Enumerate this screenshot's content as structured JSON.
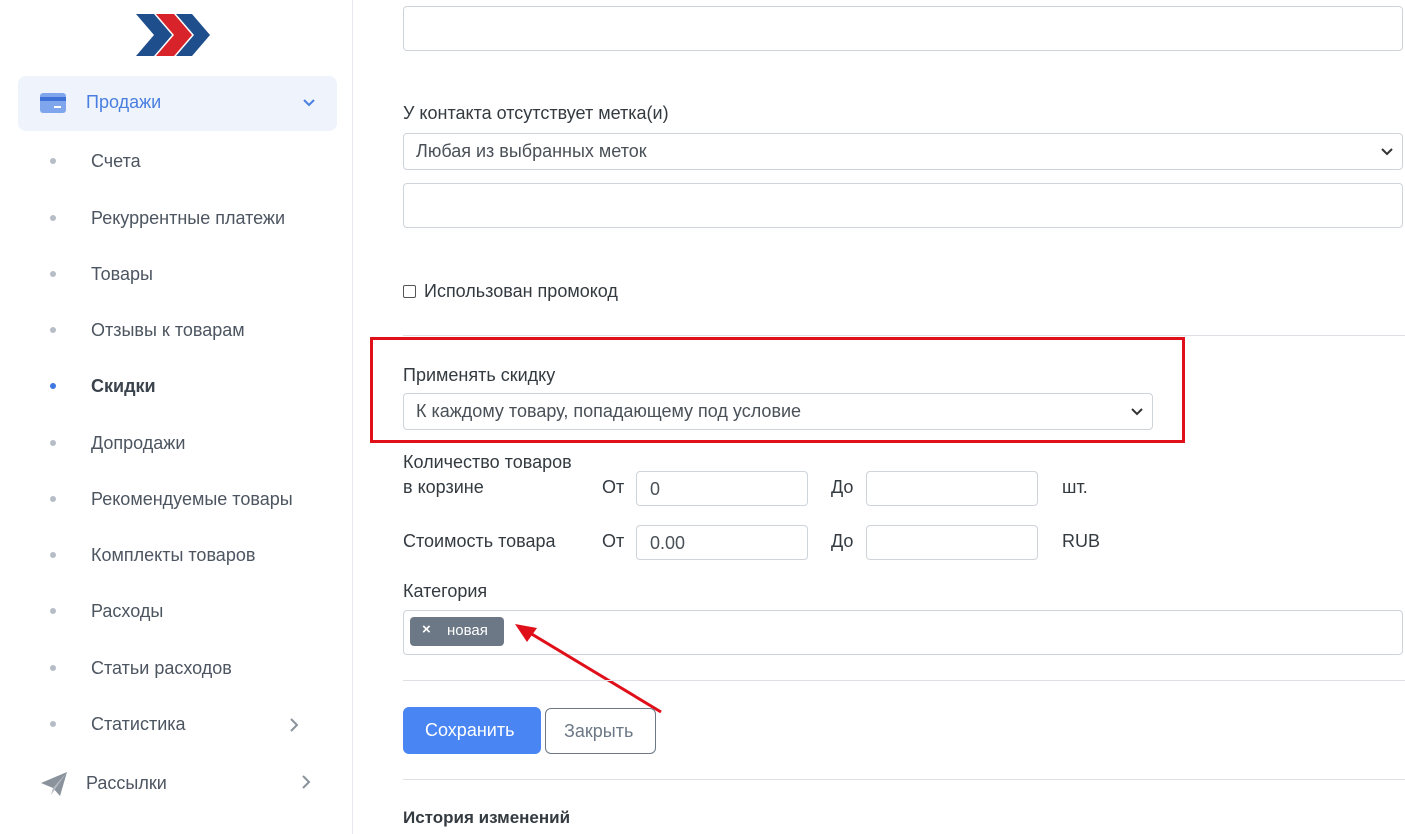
{
  "sidebar": {
    "logo_icon": "chevrons-logo-icon",
    "sales": {
      "label": "Продажи",
      "icon": "card-icon",
      "expanded": true
    },
    "items": [
      {
        "label": "Счета"
      },
      {
        "label": "Рекуррентные платежи"
      },
      {
        "label": "Товары"
      },
      {
        "label": "Отзывы к товарам"
      },
      {
        "label": "Скидки",
        "active": true
      },
      {
        "label": "Допродажи"
      },
      {
        "label": "Рекомендуемые товары"
      },
      {
        "label": "Комплекты товаров"
      },
      {
        "label": "Расходы"
      },
      {
        "label": "Статьи расходов"
      },
      {
        "label": "Статистика",
        "has_submenu": true
      }
    ],
    "mailings": {
      "label": "Рассылки",
      "icon": "paper-plane-icon"
    }
  },
  "form": {
    "tag_missing_label": "У контакта отсутствует метка(и)",
    "tag_missing_mode": "Любая из выбранных меток",
    "promo_label": "Использован промокод",
    "promo_checked": false,
    "apply_discount_label": "Применять скидку",
    "apply_discount_value": "К каждому товару, попадающему под условие",
    "qty_label_line1": "Количество товаров",
    "qty_label_line2": "в корзине",
    "from_label": "От",
    "to_label": "До",
    "qty_from": "0",
    "qty_to": "",
    "qty_unit": "шт.",
    "price_label": "Стоимость товара",
    "price_from": "0.00",
    "price_to": "",
    "price_unit": "RUB",
    "category_label": "Категория",
    "category_tag": "новая",
    "tag_remove": "×",
    "save_label": "Сохранить",
    "close_label": "Закрыть",
    "history_label": "История изменений"
  },
  "colors": {
    "accent": "#4a86f3",
    "sidebar_active_bg": "#eef3fc",
    "annotation": "#e0101a",
    "tag_bg": "#6c7886"
  }
}
